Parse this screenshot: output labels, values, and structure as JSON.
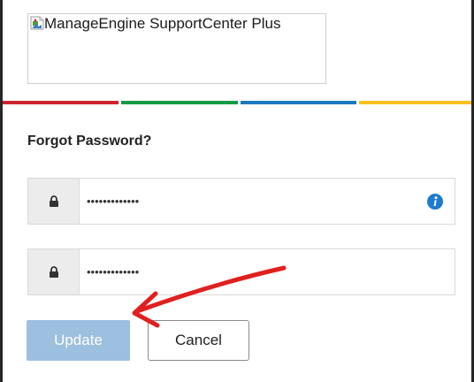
{
  "logo": {
    "alt_text": "ManageEngine SupportCenter Plus"
  },
  "color_bar": {
    "colors": [
      "#d0222e",
      "#129b47",
      "#1d79be",
      "#fbc11d"
    ]
  },
  "form": {
    "title": "Forgot Password?",
    "new_password": {
      "masked_value": "•••••••••••••",
      "icon": "lock-icon",
      "help_icon": "info-icon"
    },
    "confirm_password": {
      "masked_value": "•••••••••••••",
      "icon": "lock-icon"
    }
  },
  "buttons": {
    "update_label": "Update",
    "cancel_label": "Cancel"
  },
  "annotation": {
    "color": "#e0201f",
    "icon": "arrow-annotation"
  }
}
